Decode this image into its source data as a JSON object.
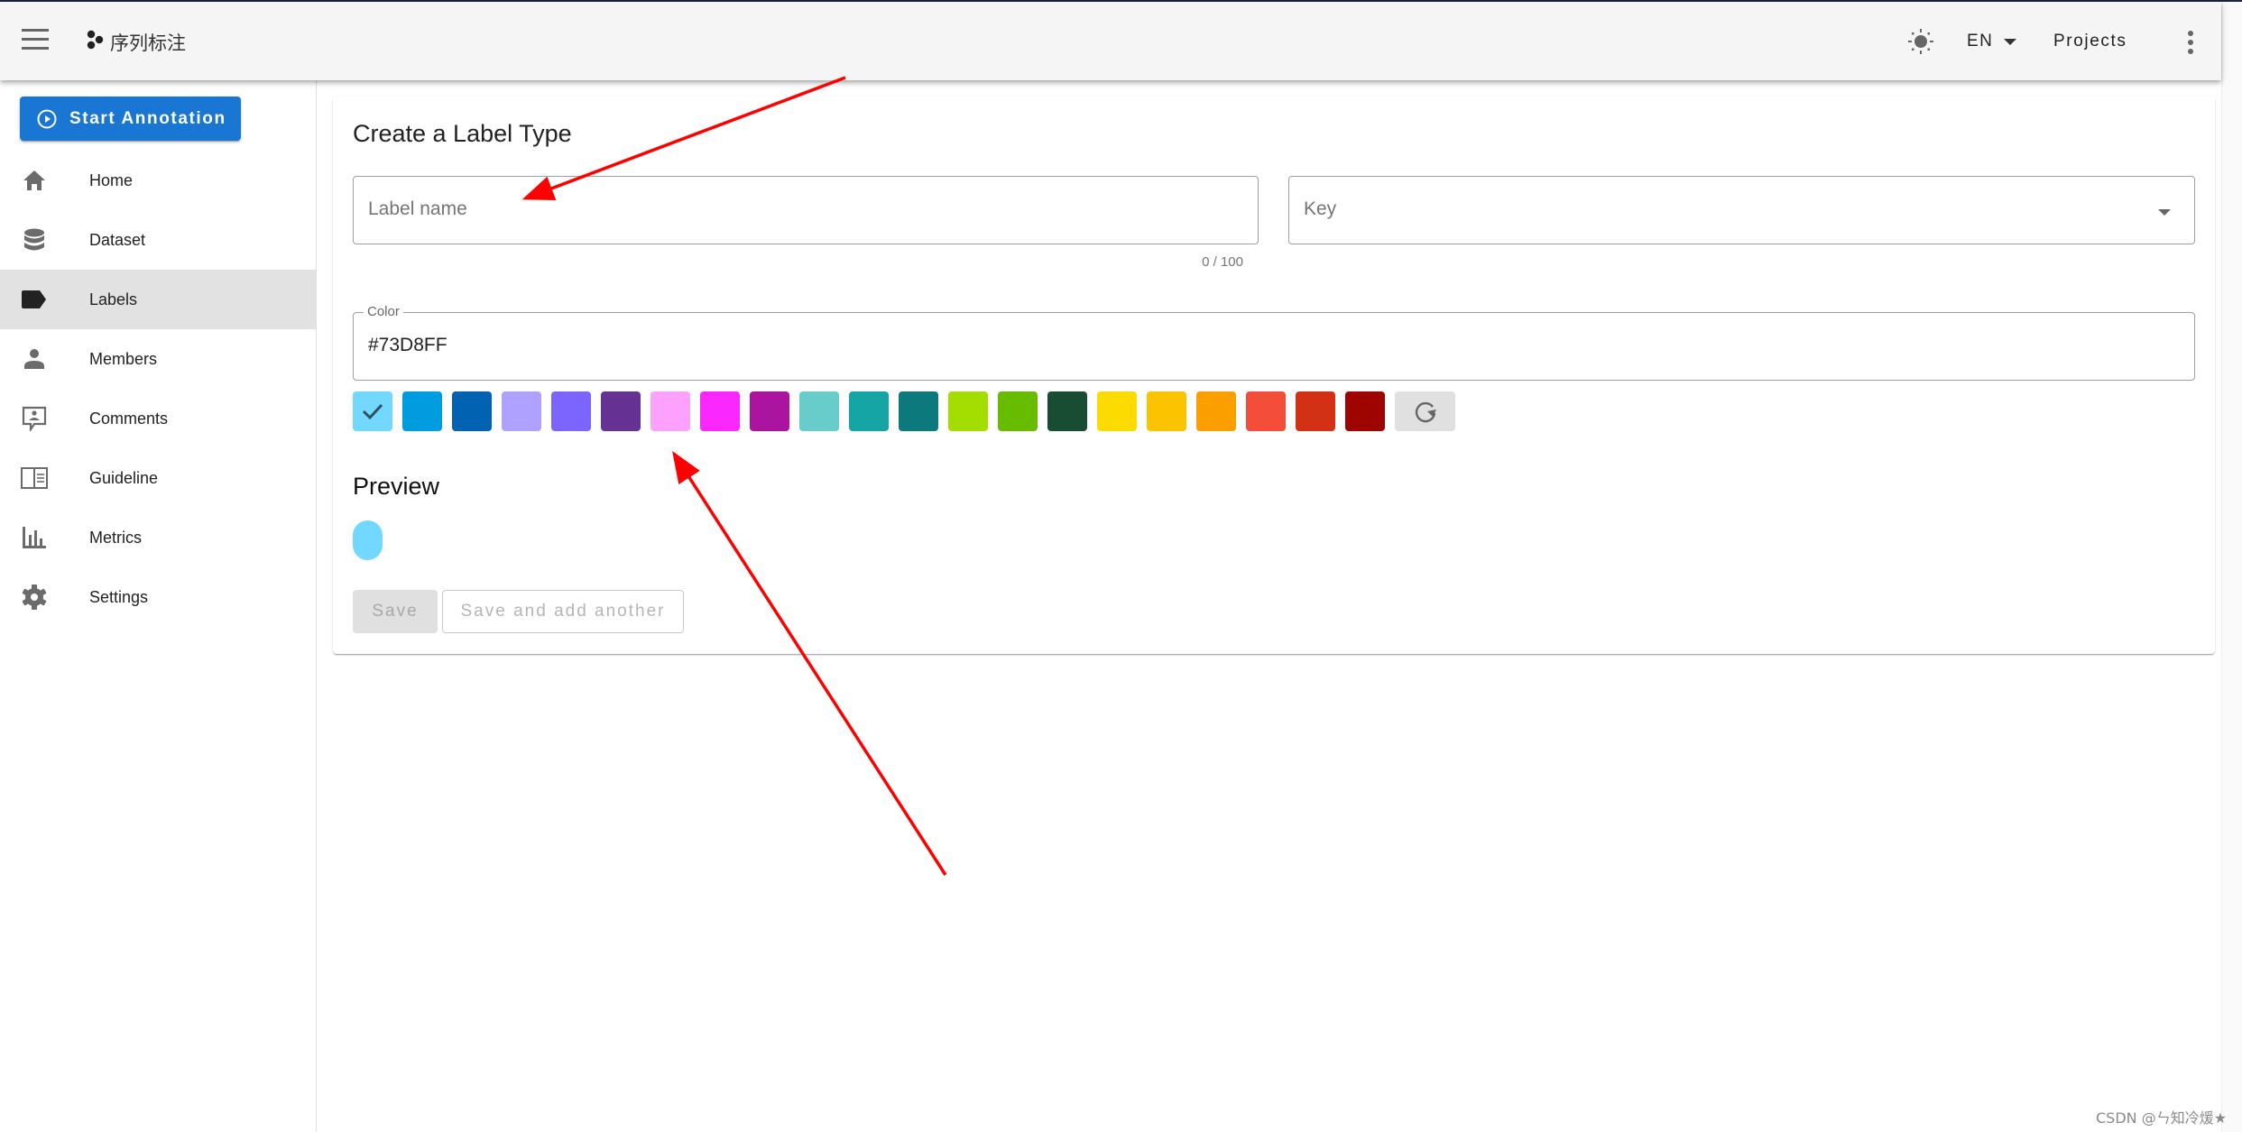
{
  "appbar": {
    "title": "序列标注",
    "language": "EN",
    "projects_label": "Projects"
  },
  "sidebar": {
    "start_button_label": "Start Annotation",
    "items": [
      {
        "label": "Home",
        "icon": "home-icon"
      },
      {
        "label": "Dataset",
        "icon": "database-icon"
      },
      {
        "label": "Labels",
        "icon": "label-icon",
        "active": true
      },
      {
        "label": "Members",
        "icon": "person-icon"
      },
      {
        "label": "Comments",
        "icon": "comment-icon"
      },
      {
        "label": "Guideline",
        "icon": "book-icon"
      },
      {
        "label": "Metrics",
        "icon": "bar-chart-icon"
      },
      {
        "label": "Settings",
        "icon": "gear-icon"
      }
    ]
  },
  "form": {
    "title": "Create a Label Type",
    "label_name": {
      "placeholder": "Label name",
      "value": "",
      "counter": "0 / 100"
    },
    "key": {
      "placeholder": "Key",
      "value": ""
    },
    "color": {
      "legend": "Color",
      "value": "#73D8FF"
    },
    "swatches": [
      "#73D8FF",
      "#009CE0",
      "#0062B1",
      "#AEA1FF",
      "#7B64FF",
      "#653294",
      "#FDA1FF",
      "#FA28FF",
      "#AB149E",
      "#68CCCA",
      "#16A5A5",
      "#0C797D",
      "#A4DD00",
      "#68BC00",
      "#194D33",
      "#FCDC00",
      "#FCC400",
      "#FB9E00",
      "#F44E3B",
      "#D33115",
      "#9F0500"
    ],
    "selected_swatch": 0,
    "preview_title": "Preview",
    "preview_color": "#73D8FF",
    "save_label": "Save",
    "save_another_label": "Save and add another"
  },
  "annotation_color": "#FF0000",
  "watermark": "CSDN @ㄣ知冷煖★"
}
